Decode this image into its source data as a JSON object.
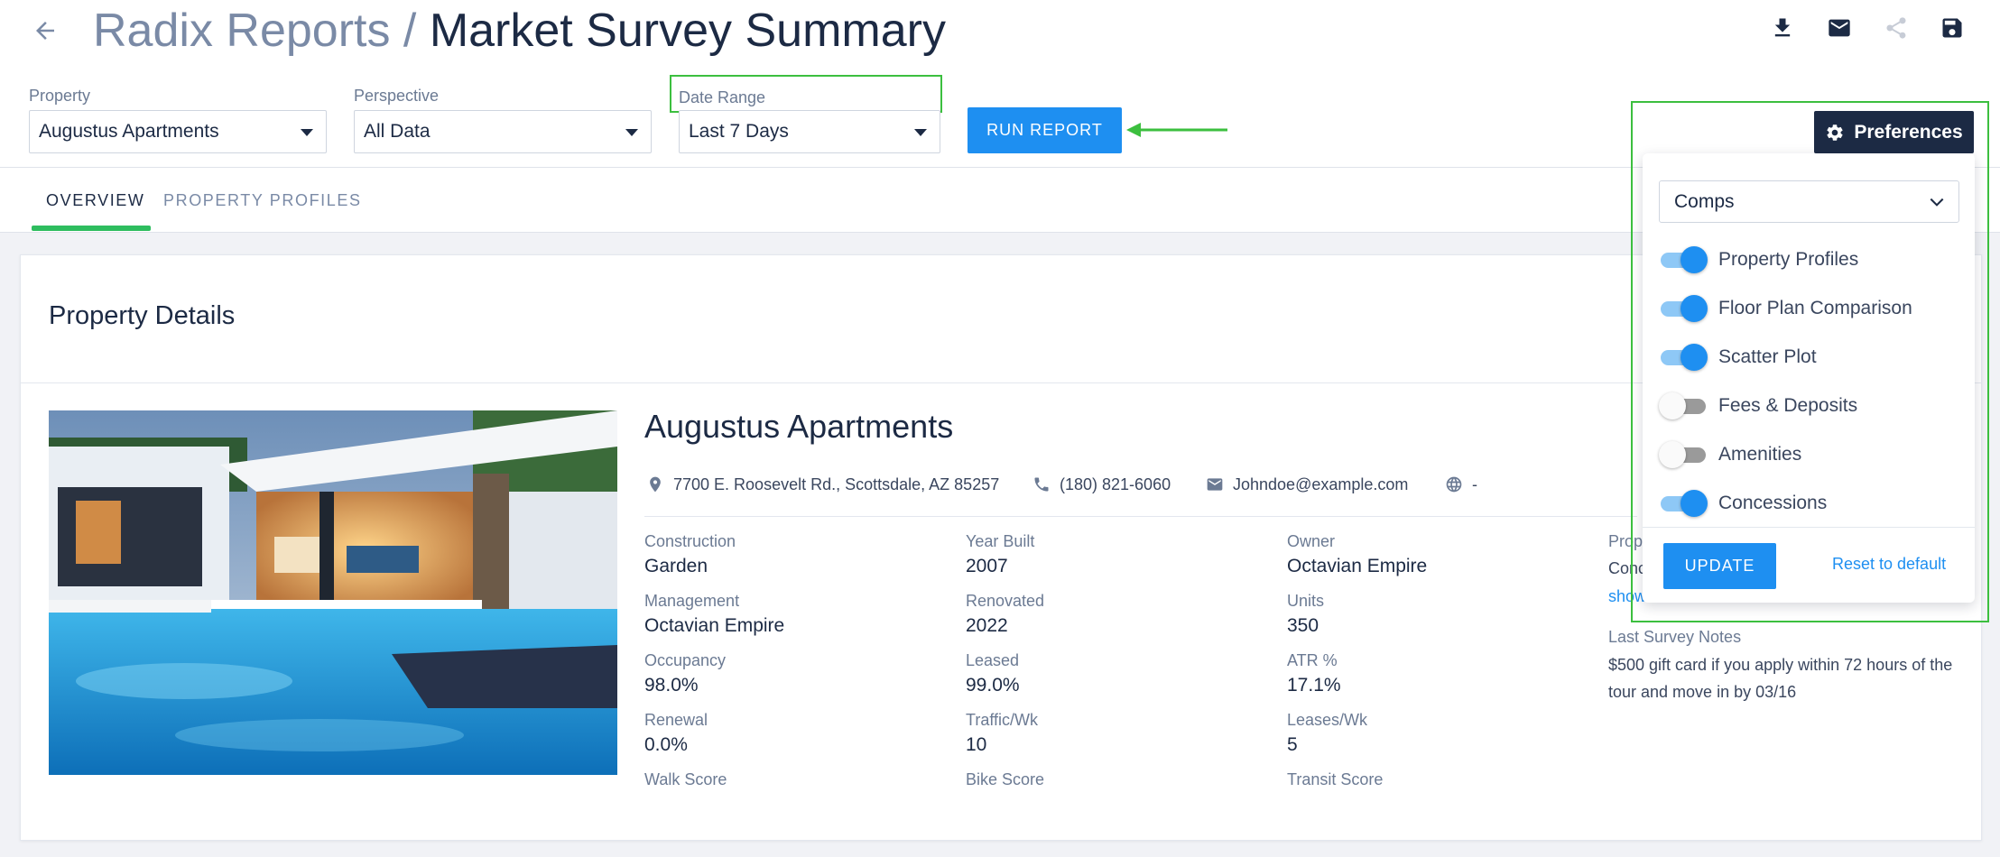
{
  "header": {
    "breadcrumb_root": "Radix Reports",
    "separator": " / ",
    "page_title": "Market Survey Summary"
  },
  "filters": {
    "property": {
      "label": "Property",
      "value": "Augustus Apartments"
    },
    "perspective": {
      "label": "Perspective",
      "value": "All Data"
    },
    "date_range": {
      "label": "Date Range",
      "value": "Last 7 Days"
    },
    "run_label": "RUN REPORT"
  },
  "preferences": {
    "button_label": "Preferences",
    "select_value": "Comps",
    "toggles": [
      {
        "label": "Property Profiles",
        "on": true
      },
      {
        "label": "Floor Plan Comparison",
        "on": true
      },
      {
        "label": "Scatter Plot",
        "on": true
      },
      {
        "label": "Fees & Deposits",
        "on": false
      },
      {
        "label": "Amenities",
        "on": false
      },
      {
        "label": "Concessions",
        "on": true
      }
    ],
    "update_label": "UPDATE",
    "reset_label": "Reset to default"
  },
  "tabs": [
    {
      "label": "OVERVIEW",
      "active": true
    },
    {
      "label": "PROPERTY PROFILES",
      "active": false
    }
  ],
  "details": {
    "section_title": "Property Details",
    "property_name": "Augustus Apartments",
    "address": "7700 E. Roosevelt Rd., Scottsdale, AZ 85257",
    "phone": "(180) 821-6060",
    "email": "Johndoe@example.com",
    "website": "-",
    "stats": [
      {
        "label": "Construction",
        "value": "Garden"
      },
      {
        "label": "Year Built",
        "value": "2007"
      },
      {
        "label": "Owner",
        "value": "Octavian Empire"
      },
      {
        "label": "Management",
        "value": "Octavian Empire"
      },
      {
        "label": "Renovated",
        "value": "2022"
      },
      {
        "label": "Units",
        "value": "350"
      },
      {
        "label": "Occupancy",
        "value": "98.0%"
      },
      {
        "label": "Leased",
        "value": "99.0%"
      },
      {
        "label": "ATR %",
        "value": "17.1%"
      },
      {
        "label": "Renewal",
        "value": "0.0%"
      },
      {
        "label": "Traffic/Wk",
        "value": "10"
      },
      {
        "label": "Leases/Wk",
        "value": "5"
      },
      {
        "label": "Walk Score",
        "value": ""
      },
      {
        "label": "Bike Score",
        "value": ""
      },
      {
        "label": "Transit Score",
        "value": ""
      }
    ],
    "partial_label": "Prop",
    "partial_text": "Conc",
    "partial_link": "show",
    "notes_label": "Last Survey Notes",
    "notes_text": "$500 gift card if you apply within 72 hours of the tour and move in by 03/16"
  },
  "colors": {
    "accent": "#1e8ff1",
    "navy": "#1c2a44",
    "highlight": "#3cbf3f",
    "tab_underline": "#2ebd5f"
  },
  "icons": {
    "back": "arrow-left-icon",
    "download": "download-icon",
    "mail": "mail-icon",
    "share": "share-icon",
    "save": "save-icon",
    "gear": "gear-icon",
    "location": "location-pin-icon",
    "phone": "phone-icon",
    "email": "envelope-icon",
    "web": "globe-icon"
  }
}
